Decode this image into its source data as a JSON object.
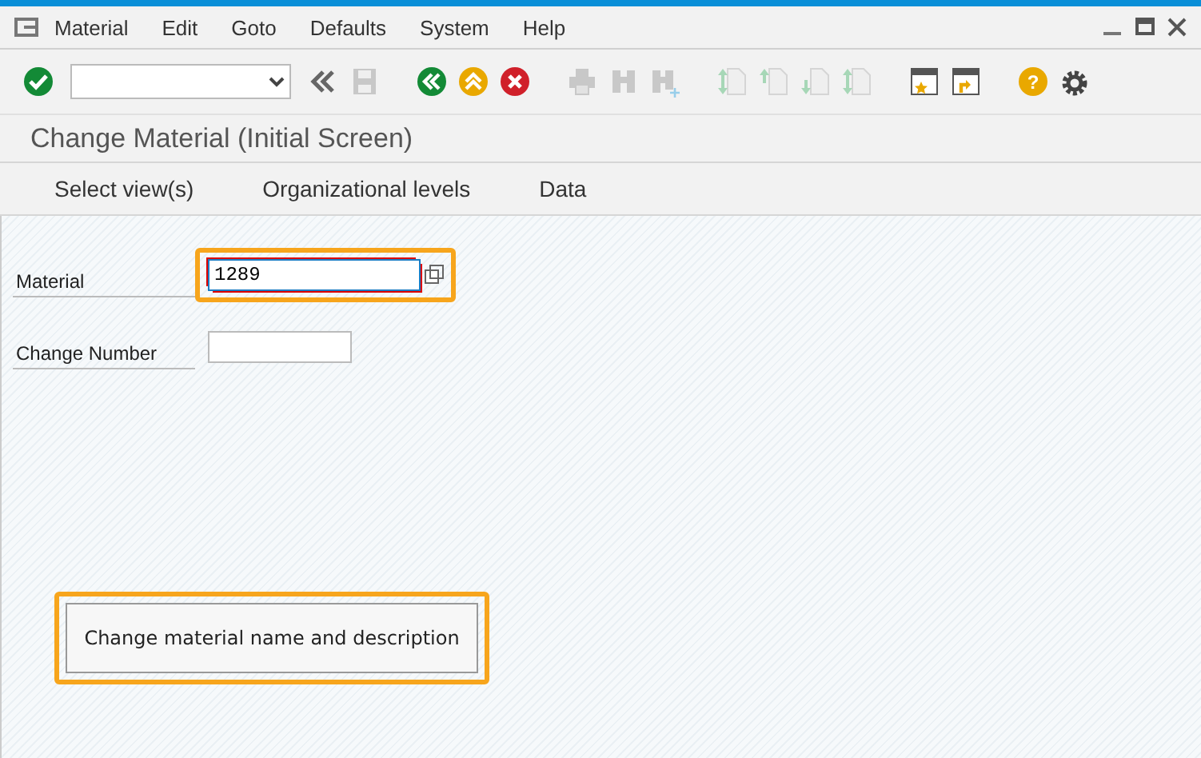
{
  "menu": [
    {
      "label": "Material"
    },
    {
      "label": "Edit"
    },
    {
      "label": "Goto"
    },
    {
      "label": "Defaults"
    },
    {
      "label": "System"
    },
    {
      "label": "Help"
    }
  ],
  "toolbar": [
    {
      "kind": "ok",
      "disabled": false
    },
    {
      "kind": "command"
    },
    {
      "kind": "collapse",
      "disabled": false
    },
    {
      "kind": "save",
      "disabled": true
    },
    {
      "kind": "gap"
    },
    {
      "kind": "back",
      "disabled": false
    },
    {
      "kind": "exit",
      "disabled": false
    },
    {
      "kind": "cancel",
      "disabled": false
    },
    {
      "kind": "gap"
    },
    {
      "kind": "print",
      "disabled": true
    },
    {
      "kind": "find",
      "disabled": true
    },
    {
      "kind": "find-next",
      "disabled": true
    },
    {
      "kind": "gap"
    },
    {
      "kind": "first-page",
      "disabled": true
    },
    {
      "kind": "prev-page",
      "disabled": true
    },
    {
      "kind": "next-page",
      "disabled": true
    },
    {
      "kind": "last-page",
      "disabled": true
    },
    {
      "kind": "gap"
    },
    {
      "kind": "new-session",
      "disabled": false
    },
    {
      "kind": "shortcut",
      "disabled": false
    },
    {
      "kind": "gap"
    },
    {
      "kind": "help",
      "disabled": false,
      "label": "?"
    },
    {
      "kind": "settings",
      "disabled": false
    }
  ],
  "title": "Change Material (Initial Screen)",
  "app_toolbar": [
    {
      "label": "Select view(s)"
    },
    {
      "label": "Organizational levels"
    },
    {
      "label": "Data"
    }
  ],
  "fields": [
    {
      "label": "Material",
      "value": "1289",
      "focused": true,
      "highlighted": true,
      "value_help": true
    },
    {
      "label": "Change Number",
      "focused": false,
      "highlighted": false,
      "value_help": false
    }
  ],
  "button": {
    "label": "Change material name and description",
    "highlighted": true
  }
}
